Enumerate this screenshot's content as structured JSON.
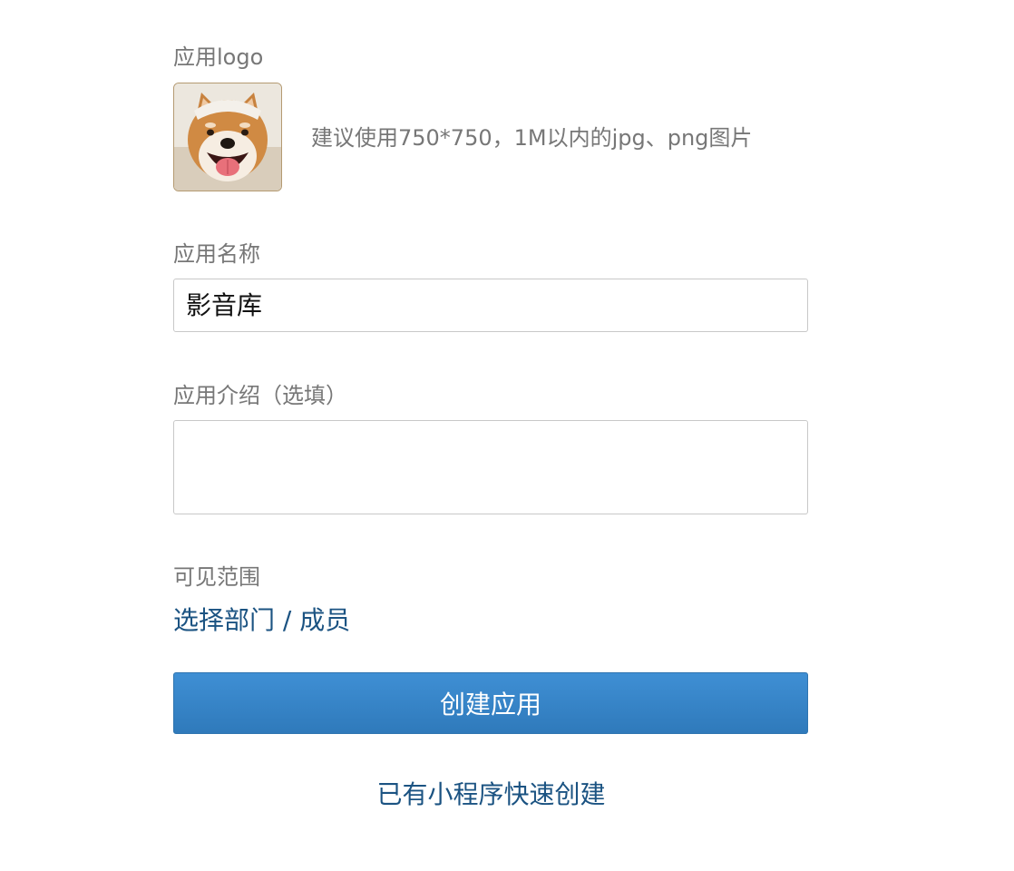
{
  "logo_section": {
    "label": "应用logo",
    "image_icon": "shiba-dog-avatar",
    "hint": "建议使用750*750，1M以内的jpg、png图片"
  },
  "name_section": {
    "label": "应用名称",
    "value": "影音库"
  },
  "description_section": {
    "label": "应用介绍（选填）",
    "value": ""
  },
  "visibility_section": {
    "label": "可见范围",
    "link_text": "选择部门 / 成员"
  },
  "actions": {
    "create_button": "创建应用",
    "mini_program_link": "已有小程序快速创建"
  },
  "colors": {
    "label_text": "#777777",
    "link": "#1b5382",
    "button_top": "#3f8fd4",
    "button_bottom": "#2f7abb",
    "input_border": "#c8c8c8"
  }
}
